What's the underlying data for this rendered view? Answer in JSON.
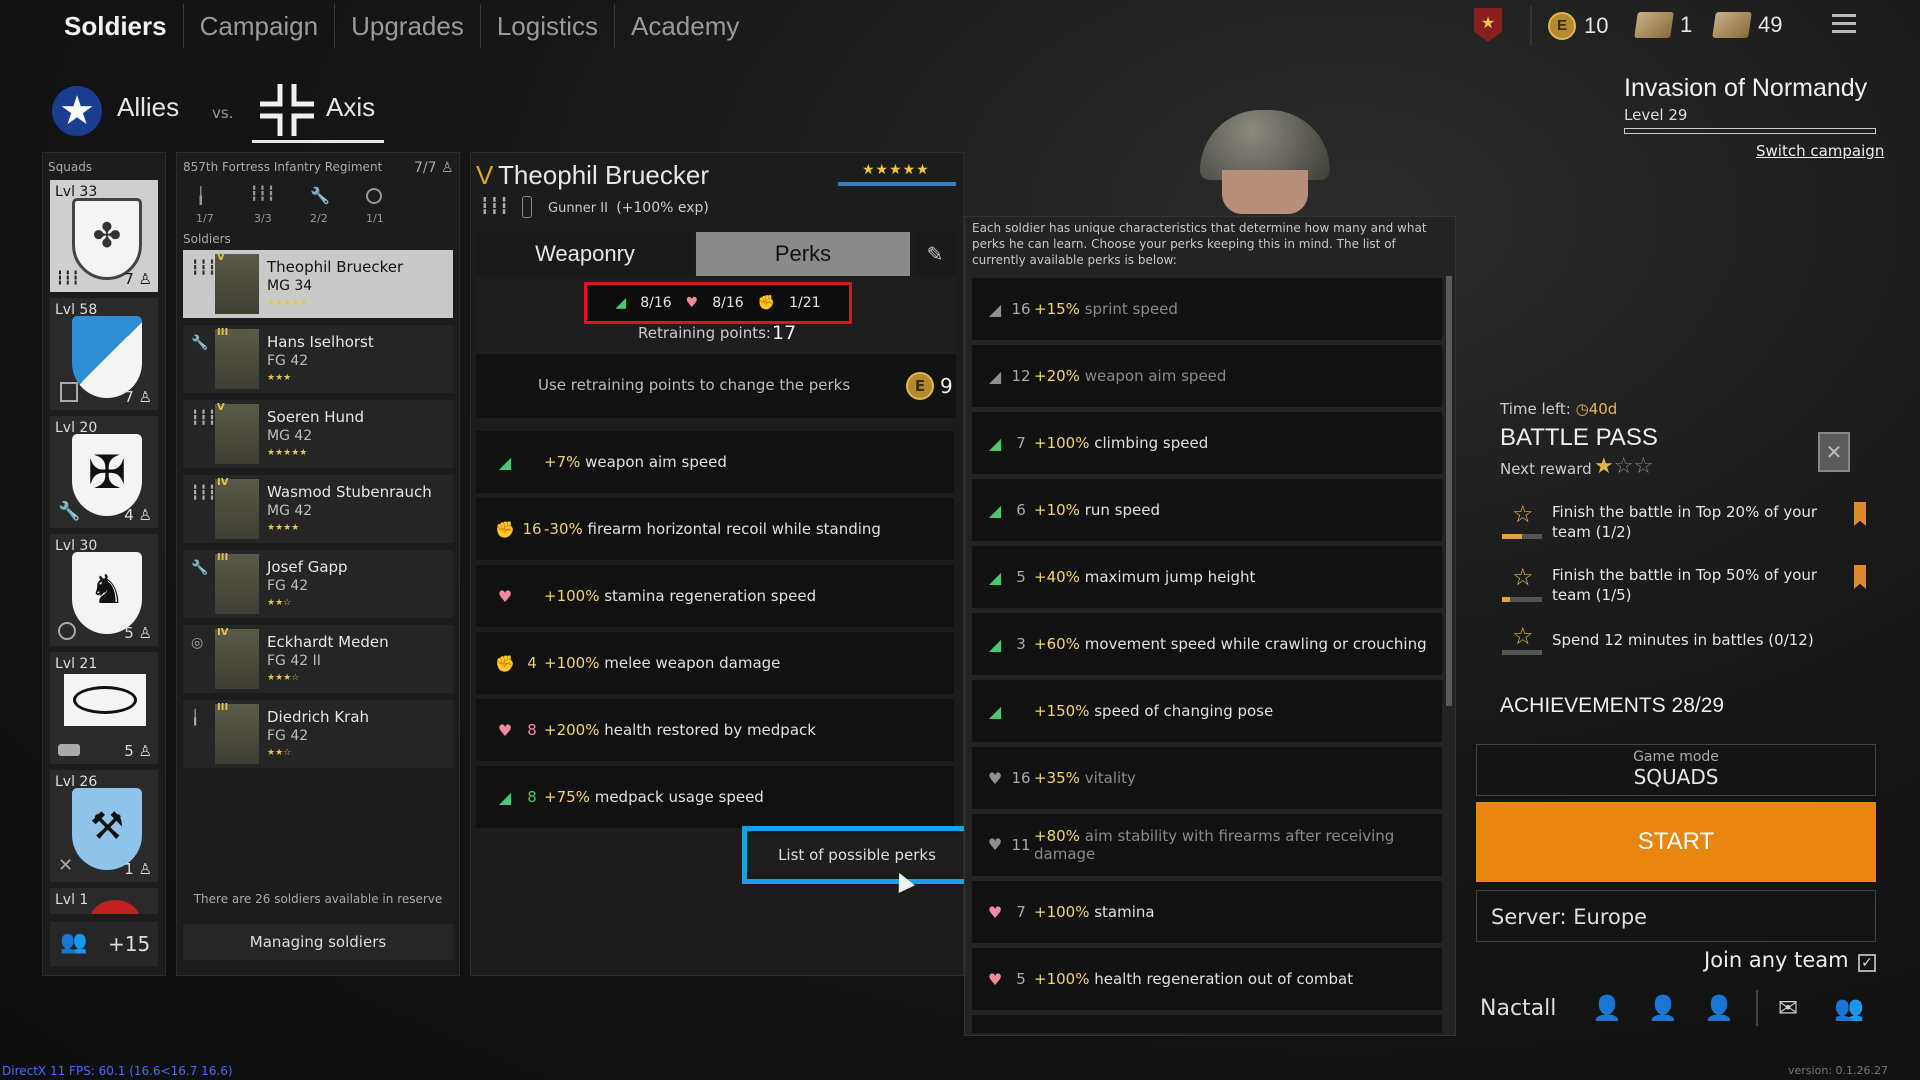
{
  "nav": {
    "tabs": [
      "Soldiers",
      "Campaign",
      "Upgrades",
      "Logistics",
      "Academy"
    ],
    "resources": {
      "coins": "10",
      "cards_a": "1",
      "cards_b": "49"
    }
  },
  "factions": {
    "allies": "Allies",
    "vs": "vs.",
    "axis": "Axis"
  },
  "campaign": {
    "title": "Invasion of Normandy",
    "level": "Level 29",
    "switch": "Switch campaign"
  },
  "squads": {
    "header": "Squads",
    "items": [
      {
        "level": "Lvl 33",
        "count": "7"
      },
      {
        "level": "Lvl 58",
        "count": "7"
      },
      {
        "level": "Lvl 20",
        "count": "4"
      },
      {
        "level": "Lvl 30",
        "count": "5"
      },
      {
        "level": "Lvl 21",
        "count": "5"
      },
      {
        "level": "Lvl 26",
        "count": "1"
      },
      {
        "level": "Lvl 1",
        "count": ""
      }
    ],
    "more": "+15"
  },
  "regiment": {
    "name": "857th Fortress Infantry Regiment",
    "count": "7/7",
    "slots": [
      "1/7",
      "3/3",
      "2/2",
      "1/1"
    ],
    "soldiers_label": "Soldiers",
    "soldiers": [
      {
        "rank": "V",
        "name": "Theophil Bruecker",
        "weapon": "MG 34",
        "stars": "★★★★★"
      },
      {
        "rank": "III",
        "name": "Hans Iselhorst",
        "weapon": "FG 42",
        "stars": "★★★"
      },
      {
        "rank": "V",
        "name": "Soeren Hund",
        "weapon": "MG 42",
        "stars": "★★★★★"
      },
      {
        "rank": "IV",
        "name": "Wasmod Stubenrauch",
        "weapon": "MG 42",
        "stars": "★★★★"
      },
      {
        "rank": "III",
        "name": "Josef Gapp",
        "weapon": "FG 42",
        "stars": "★★☆"
      },
      {
        "rank": "IV",
        "name": "Eckhardt Meden",
        "weapon": "FG 42 II",
        "stars": "★★★☆"
      },
      {
        "rank": "III",
        "name": "Diedrich Krah",
        "weapon": "FG 42",
        "stars": "★★☆"
      }
    ],
    "reserve_text": "There are 26 soldiers available in reserve",
    "reserve_count": "26",
    "managing": "Managing soldiers"
  },
  "soldier": {
    "rank": "V",
    "name": "Theophil Bruecker",
    "class": "Gunner II",
    "exp": "(+100% exp)",
    "stars": "★★★★★",
    "tabs": {
      "weaponry": "Weaponry",
      "perks": "Perks"
    },
    "points": {
      "agility": "8/16",
      "vitality": "8/16",
      "strength": "1/21"
    },
    "retraining_label": "Retraining points:",
    "retraining_value": "17",
    "retrain_text": "Use retraining points to change the perks",
    "retrain_cost": "9",
    "perks": [
      {
        "type": "g",
        "cost": "",
        "value": "+7%",
        "text": "weapon aim speed"
      },
      {
        "type": "y",
        "cost": "16",
        "value": "-30%",
        "text": "firearm horizontal recoil while standing"
      },
      {
        "type": "h",
        "cost": "",
        "value": "+100%",
        "text": "stamina regeneration speed"
      },
      {
        "type": "y",
        "cost": "4",
        "value": "+100%",
        "text": "melee weapon damage"
      },
      {
        "type": "h",
        "cost": "8",
        "value": "+200%",
        "text": "health restored by medpack"
      },
      {
        "type": "g",
        "cost": "8",
        "value": "+75%",
        "text": "medpack usage speed"
      }
    ],
    "list_button": "List of possible perks"
  },
  "perk_list": {
    "intro": "Each soldier has unique characteristics that determine how many and what perks he can learn. Choose your perks keeping this in mind. The list of currently available perks is below:",
    "items": [
      {
        "type": "gray",
        "cost": "16",
        "value": "+15%",
        "text": "sprint speed"
      },
      {
        "type": "gray",
        "cost": "12",
        "value": "+20%",
        "text": "weapon aim speed"
      },
      {
        "type": "g",
        "cost": "7",
        "value": "+100%",
        "text": "climbing speed"
      },
      {
        "type": "g",
        "cost": "6",
        "value": "+10%",
        "text": "run speed"
      },
      {
        "type": "g",
        "cost": "5",
        "value": "+40%",
        "text": "maximum jump height"
      },
      {
        "type": "g",
        "cost": "3",
        "value": "+60%",
        "text": "movement speed while crawling or crouching"
      },
      {
        "type": "g",
        "cost": "",
        "value": "+150%",
        "text": "speed of changing pose"
      },
      {
        "type": "gray",
        "cost": "16",
        "value": "+35%",
        "text": "vitality"
      },
      {
        "type": "gray",
        "cost": "11",
        "value": "+80%",
        "text": "aim stability with firearms after receiving damage"
      },
      {
        "type": "h",
        "cost": "7",
        "value": "+100%",
        "text": "stamina"
      },
      {
        "type": "h",
        "cost": "5",
        "value": "+100%",
        "text": "health regeneration out of combat"
      }
    ]
  },
  "battle_pass": {
    "time_left_label": "Time left:",
    "time_left": "40d",
    "title": "BATTLE PASS",
    "next_reward": "Next reward",
    "tasks": [
      {
        "text": "Finish the battle in Top 20% of your team (1/2)",
        "progress": 0.5,
        "bookmark": true
      },
      {
        "text": "Finish the battle in Top 50% of your team (1/5)",
        "progress": 0.2,
        "bookmark": true
      },
      {
        "text": "Spend 12 minutes in battles (0/12)",
        "progress": 0,
        "bookmark": false
      }
    ]
  },
  "achievements": "ACHIEVEMENTS 28/29",
  "game_mode": {
    "label": "Game mode",
    "value": "SQUADS"
  },
  "start": "START",
  "server": "Server: Europe",
  "join_any": "Join any team",
  "player": "Nactall",
  "footer": {
    "fps": "DirectX 11 FPS: 60.1 (16.6<16.7 16.6)",
    "version": "version: 0.1.26.27"
  },
  "colors": {
    "accent": "#e8860f",
    "selected_border_red": "#e0141c",
    "highlight_blue": "#1aa0e8",
    "green": "#49c96b",
    "heart": "#f28aa0",
    "yellow": "#e6cf66"
  }
}
